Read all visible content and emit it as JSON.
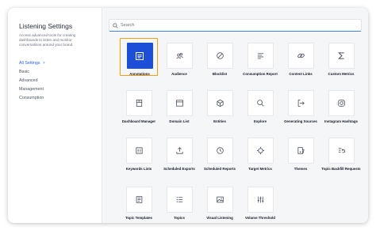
{
  "sidebar": {
    "title": "Listening Settings",
    "description": "Access advanced tools for creating dashboards to listen and monitor conversations around your brand.",
    "items": [
      {
        "label": "All Settings",
        "active": true
      },
      {
        "label": "Basic"
      },
      {
        "label": "Advanced"
      },
      {
        "label": "Management"
      },
      {
        "label": "Consumption"
      }
    ]
  },
  "search": {
    "placeholder": "Search",
    "icon": "search-icon"
  },
  "colors": {
    "accent": "#1d4ed8",
    "selection": "#f59e0b",
    "link": "#2563eb"
  },
  "tiles": [
    {
      "label": "Annotations",
      "icon": "annotations-icon",
      "selected": true
    },
    {
      "label": "Audience",
      "icon": "audience-icon"
    },
    {
      "label": "Blocklist",
      "icon": "blocklist-icon"
    },
    {
      "label": "Consumption Report",
      "icon": "consumption-report-icon"
    },
    {
      "label": "Content Links",
      "icon": "link-icon"
    },
    {
      "label": "Custom Metrics",
      "icon": "sigma-icon"
    },
    {
      "label": "Dashboard Manager",
      "icon": "dashboard-manager-icon"
    },
    {
      "label": "Domain List",
      "icon": "domain-list-icon"
    },
    {
      "label": "Entities",
      "icon": "entities-icon"
    },
    {
      "label": "Explore",
      "icon": "explore-icon"
    },
    {
      "label": "Generating Sources",
      "icon": "generating-sources-icon"
    },
    {
      "label": "Instagram Hashtags",
      "icon": "instagram-icon"
    },
    {
      "label": "Keywords Lists",
      "icon": "keywords-lists-icon"
    },
    {
      "label": "Scheduled Exports",
      "icon": "export-icon"
    },
    {
      "label": "Scheduled Reports",
      "icon": "clock-icon"
    },
    {
      "label": "Target Metrics",
      "icon": "target-icon"
    },
    {
      "label": "Themes",
      "icon": "themes-icon"
    },
    {
      "label": "Topic Backfill Requests",
      "icon": "backfill-icon"
    },
    {
      "label": "Topic Templates",
      "icon": "topic-templates-icon"
    },
    {
      "label": "Topics",
      "icon": "topics-icon"
    },
    {
      "label": "Visual Listening",
      "icon": "visual-listening-icon"
    },
    {
      "label": "Volume Threshold",
      "icon": "volume-threshold-icon"
    }
  ]
}
